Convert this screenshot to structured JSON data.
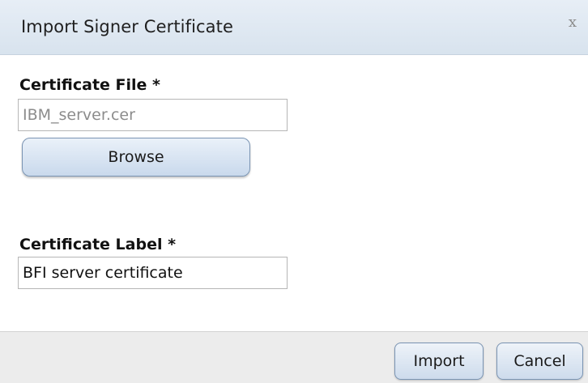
{
  "dialog": {
    "title": "Import Signer Certificate",
    "close_label": "x"
  },
  "certificate_file": {
    "label": "Certificate File *",
    "value": "IBM_server.cer",
    "browse_label": "Browse"
  },
  "certificate_label": {
    "label": "Certificate Label *",
    "value": "BFI server certificate"
  },
  "footer": {
    "import_label": "Import",
    "cancel_label": "Cancel"
  }
}
